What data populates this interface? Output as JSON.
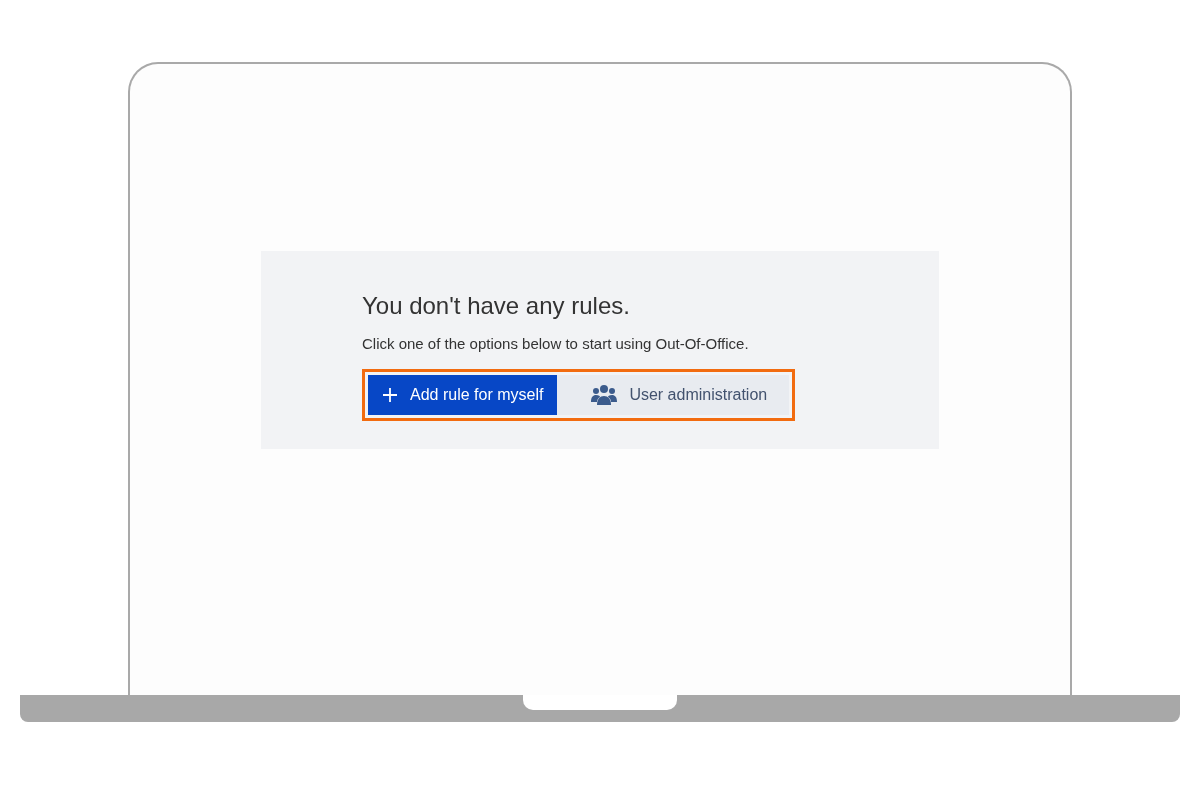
{
  "empty_state": {
    "title": "You don't have any rules.",
    "message": "Click one of the options below to start using Out-Of-Office."
  },
  "button_group": {
    "highlighted": true,
    "buttons": [
      {
        "kind": "primary",
        "label": "Add rule for myself"
      },
      {
        "kind": "secondary",
        "label": "User administration"
      }
    ]
  }
}
